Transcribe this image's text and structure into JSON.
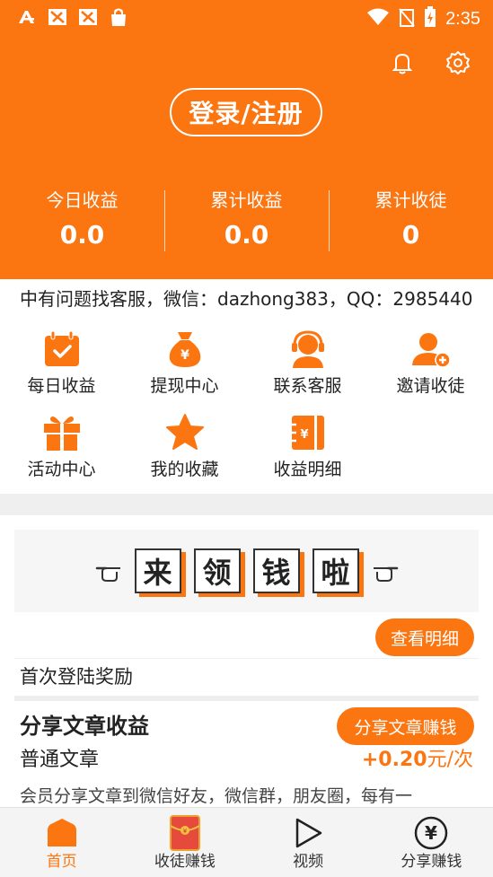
{
  "status_bar": {
    "time": "2:35"
  },
  "header": {
    "login_label": "登录/注册",
    "stats": [
      {
        "label": "今日收益",
        "value": "0.0"
      },
      {
        "label": "累计收益",
        "value": "0.0"
      },
      {
        "label": "累计收徒",
        "value": "0"
      }
    ]
  },
  "notice": {
    "text": "中有问题找客服，微信：dazhong383，QQ：2985440"
  },
  "menu": {
    "row1": [
      {
        "label": "每日收益",
        "icon": "calendar-check-icon"
      },
      {
        "label": "提现中心",
        "icon": "money-bag-icon"
      },
      {
        "label": "联系客服",
        "icon": "headset-icon"
      },
      {
        "label": "邀请收徒",
        "icon": "add-user-icon"
      }
    ],
    "row2": [
      {
        "label": "活动中心",
        "icon": "gift-icon"
      },
      {
        "label": "我的收藏",
        "icon": "star-icon"
      },
      {
        "label": "收益明细",
        "icon": "wallet-icon"
      }
    ]
  },
  "banner": {
    "chars": [
      "来",
      "领",
      "钱",
      "啦"
    ]
  },
  "rewards": {
    "detail_button": "查看明细",
    "first_login": "首次登陆奖励"
  },
  "share": {
    "title": "分享文章收益",
    "button": "分享文章赚钱",
    "article_type": "普通文章",
    "reward_amount": "+0.20",
    "reward_unit": "元/次",
    "description": "会员分享文章到微信好友，微信群，朋友圈，每有一"
  },
  "bottom_nav": [
    {
      "label": "首页",
      "icon": "home-icon",
      "active": true
    },
    {
      "label": "收徒赚钱",
      "icon": "red-envelope-icon",
      "active": false
    },
    {
      "label": "视频",
      "icon": "play-icon",
      "active": false
    },
    {
      "label": "分享赚钱",
      "icon": "yuan-coin-icon",
      "active": false
    }
  ],
  "colors": {
    "accent": "#fb7511",
    "background": "#ffffff",
    "separator": "#efefef"
  }
}
